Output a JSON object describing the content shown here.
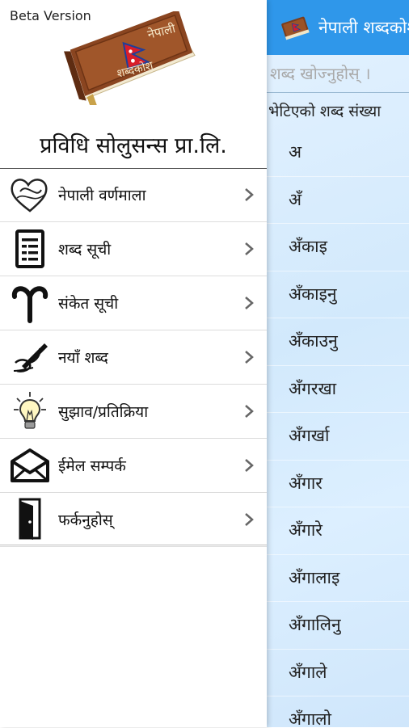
{
  "app": {
    "title": "नेपाली शब्दकोश",
    "search_placeholder": "शब्द खोज्नुहोस् ।",
    "result_label": "भेटिएको शब्द संख्या",
    "book_cover_text": [
      "नेपाली",
      "शब्दकोश"
    ]
  },
  "drawer": {
    "beta": "Beta Version",
    "company": "प्रविधि सोलुसन्स प्रा.लि.",
    "items": [
      {
        "label": "नेपाली वर्णमाला",
        "icon": "heart-calligraphy-icon"
      },
      {
        "label": "शब्द सूची",
        "icon": "document-list-icon"
      },
      {
        "label": "संकेत सूची",
        "icon": "symbol-icon"
      },
      {
        "label": "नयाँ शब्द",
        "icon": "pen-hand-icon"
      },
      {
        "label": "सुझाव/प्रतिक्रिया",
        "icon": "lightbulb-icon"
      },
      {
        "label": "ईमेल सम्पर्क",
        "icon": "envelope-icon"
      },
      {
        "label": "फर्कनुहोस्",
        "icon": "exit-door-icon"
      }
    ]
  },
  "words": [
    "अ",
    "अँ",
    "अँकाइ",
    "अँकाइनु",
    "अँकाउनु",
    "अँगरखा",
    "अँगर्खा",
    "अँगार",
    "अँगारे",
    "अँगालाइ",
    "अँगालिनु",
    "अँगाले",
    "अँगालो"
  ],
  "colors": {
    "appbar": "#2f97ea",
    "list_bg": "#d9ecfc",
    "drawer_bg": "#ffffff"
  }
}
